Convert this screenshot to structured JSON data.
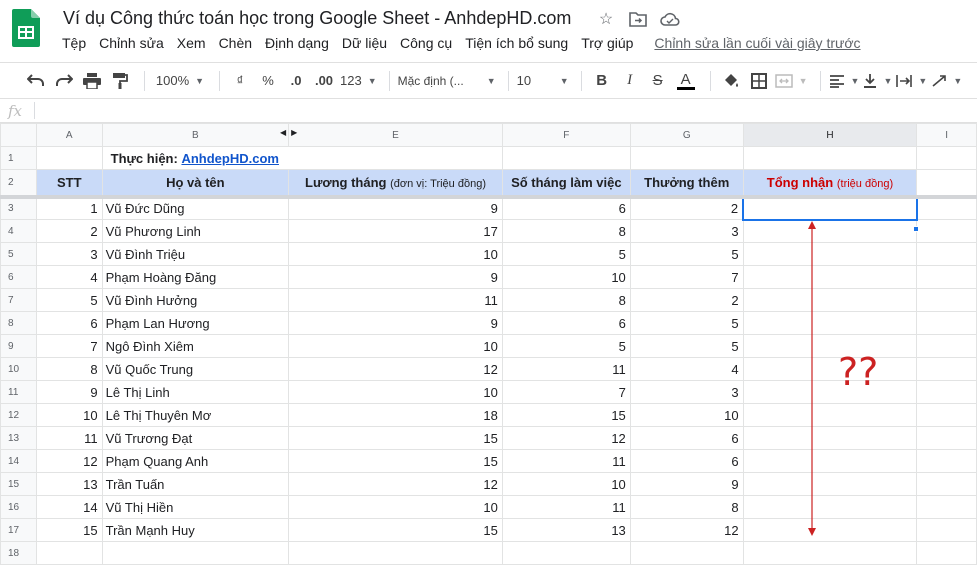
{
  "document": {
    "title": "Ví dụ Công thức toán học trong Google Sheet - AnhdepHD.com",
    "icons": [
      "star-icon",
      "move-to-folder-icon",
      "cloud-status-icon"
    ]
  },
  "menu": {
    "items": [
      "Tệp",
      "Chỉnh sửa",
      "Xem",
      "Chèn",
      "Định dạng",
      "Dữ liệu",
      "Công cụ",
      "Tiện ích bổ sung",
      "Trợ giúp"
    ],
    "last_edit": "Chỉnh sửa lần cuối vài giây trước"
  },
  "toolbar": {
    "zoom": "100%",
    "currency": "₫",
    "percent": "%",
    "decrease_decimal": ".0",
    "increase_decimal": ".00",
    "more_formats": "123",
    "font": "Mặc định (...",
    "font_size": "10",
    "bold": "B",
    "italic": "I",
    "strike": "S",
    "text_color": "A",
    "text_color_value": "#000000"
  },
  "formula_bar": {
    "fx": "fx",
    "value": ""
  },
  "columns": [
    "A",
    "B",
    "E",
    "F",
    "G",
    "H",
    "I"
  ],
  "selected_column": "H",
  "row_numbers": [
    "1",
    "2",
    "3",
    "4",
    "5",
    "6",
    "7",
    "8",
    "9",
    "10",
    "11",
    "12",
    "13",
    "14",
    "15",
    "16",
    "17",
    "18"
  ],
  "credit": {
    "label": "Thực hiện:",
    "link": "AnhdepHD.com"
  },
  "headers": {
    "stt": "STT",
    "name": "Họ và tên",
    "salary": "Lương tháng",
    "salary_unit": "(đơn vị: Triệu đồng)",
    "months": "Số tháng làm việc",
    "bonus": "Thưởng thêm",
    "total": "Tổng nhận",
    "total_unit": "(triệu đồng)"
  },
  "rows": [
    {
      "stt": "1",
      "name": "Vũ Đức Dũng",
      "salary": "9",
      "months": "6",
      "bonus": "2"
    },
    {
      "stt": "2",
      "name": "Vũ Phương Linh",
      "salary": "17",
      "months": "8",
      "bonus": "3"
    },
    {
      "stt": "3",
      "name": "Vũ Đình Triệu",
      "salary": "10",
      "months": "5",
      "bonus": "5"
    },
    {
      "stt": "4",
      "name": "Phạm Hoàng Đăng",
      "salary": "9",
      "months": "10",
      "bonus": "7"
    },
    {
      "stt": "5",
      "name": "Vũ Đình Hưởng",
      "salary": "11",
      "months": "8",
      "bonus": "2"
    },
    {
      "stt": "6",
      "name": "Phạm Lan Hương",
      "salary": "9",
      "months": "6",
      "bonus": "5"
    },
    {
      "stt": "7",
      "name": "Ngô Đình Xiêm",
      "salary": "10",
      "months": "5",
      "bonus": "5"
    },
    {
      "stt": "8",
      "name": "Vũ Quốc Trung",
      "salary": "12",
      "months": "11",
      "bonus": "4"
    },
    {
      "stt": "9",
      "name": "Lê Thị Linh",
      "salary": "10",
      "months": "7",
      "bonus": "3"
    },
    {
      "stt": "10",
      "name": "Lê Thị Thuyên Mơ",
      "salary": "18",
      "months": "15",
      "bonus": "10"
    },
    {
      "stt": "11",
      "name": "Vũ Trương Đạt",
      "salary": "15",
      "months": "12",
      "bonus": "6"
    },
    {
      "stt": "12",
      "name": "Phạm Quang Anh",
      "salary": "15",
      "months": "11",
      "bonus": "6"
    },
    {
      "stt": "13",
      "name": "Trần Tuấn",
      "salary": "12",
      "months": "10",
      "bonus": "9"
    },
    {
      "stt": "14",
      "name": "Vũ Thị Hiền",
      "salary": "10",
      "months": "11",
      "bonus": "8"
    },
    {
      "stt": "15",
      "name": "Trần Mạnh Huy",
      "salary": "15",
      "months": "13",
      "bonus": "12"
    }
  ],
  "annotation": {
    "text": "??",
    "color": "#cc2222"
  },
  "colors": {
    "header_fill": "#c9daf8",
    "total_header_text": "#cc0000",
    "selection": "#1a73e8",
    "link": "#1155cc"
  }
}
